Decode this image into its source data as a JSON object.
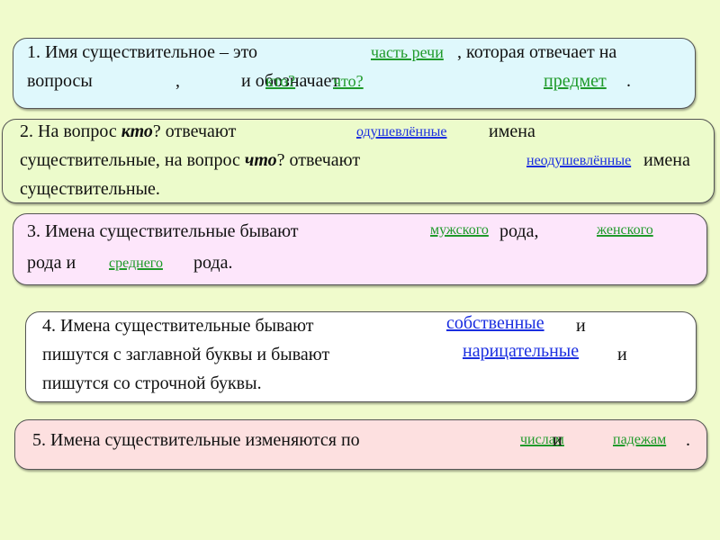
{
  "colors": {
    "background": "#f0fbcc",
    "green_answer": "#1f9a2a",
    "blue_answer": "#1a2ee0"
  },
  "box1": {
    "line1": "1. Имя существительное – это",
    "after_part": ", которая отвечает на",
    "line2a": "вопросы",
    "comma": ",",
    "line2b": "и обозначает",
    "period": ".",
    "answers": {
      "part_of_speech": "часть речи",
      "who": "кто?",
      "what": "что?",
      "object": "предмет"
    }
  },
  "box2": {
    "line1a": "2. На вопрос ",
    "kto": "кто",
    "line1b": "? отвечают",
    "line1c": "имена",
    "line2a": "существительные, на вопрос ",
    "chto": "что",
    "line2b": "? отвечают",
    "line2c": "имена",
    "line3": "существительные.",
    "answers": {
      "animate": "одушевлённые",
      "inanimate": "неодушевлённые"
    }
  },
  "box3": {
    "line1": "3. Имена существительные бывают",
    "rod1": "рода,",
    "line2a": "рода и",
    "rod3": "рода.",
    "answers": {
      "masculine": "мужского",
      "feminine": "женского",
      "neuter": "среднего"
    }
  },
  "box4": {
    "line1": "4. Имена существительные бывают",
    "i1": "и",
    "line2": "пишутся с заглавной буквы и бывают",
    "i2": "и",
    "line3": "пишутся со строчной буквы.",
    "answers": {
      "proper": "собственные",
      "common": "нарицательные"
    }
  },
  "box5": {
    "line1": "5. Имена существительные изменяются по",
    "i": "и",
    "period": ".",
    "answers": {
      "numbers": "числам",
      "cases": "падежам"
    }
  }
}
